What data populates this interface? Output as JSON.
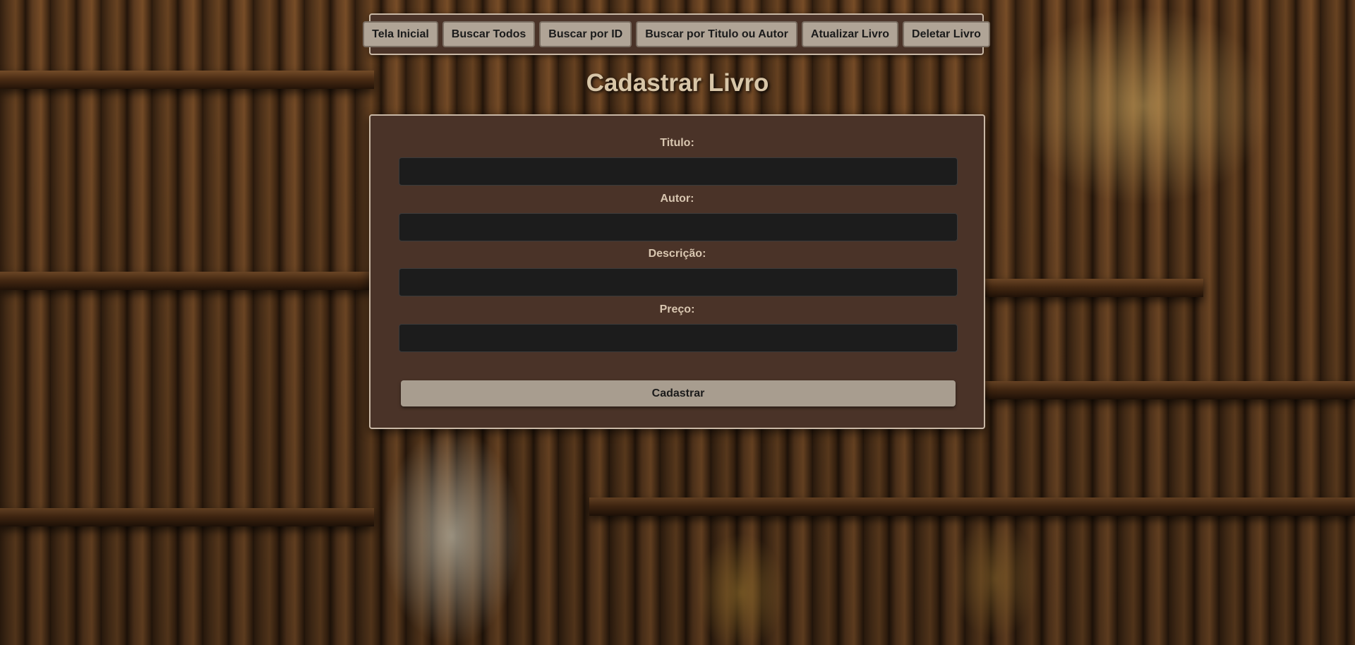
{
  "nav": {
    "items": [
      {
        "label": "Tela Inicial"
      },
      {
        "label": "Buscar Todos"
      },
      {
        "label": "Buscar por ID"
      },
      {
        "label": "Buscar por Titulo ou Autor"
      },
      {
        "label": "Atualizar Livro"
      },
      {
        "label": "Deletar Livro"
      }
    ]
  },
  "page": {
    "title": "Cadastrar Livro"
  },
  "form": {
    "fields": [
      {
        "label": "Titulo:",
        "value": ""
      },
      {
        "label": "Autor:",
        "value": ""
      },
      {
        "label": "Descrição:",
        "value": ""
      },
      {
        "label": "Preço:",
        "value": ""
      }
    ],
    "submit_label": "Cadastrar"
  },
  "colors": {
    "panel_bg": "#4a3328",
    "panel_border": "#c9b8a6",
    "button_bg": "#b0a496",
    "input_bg": "#1c1c1c",
    "title_color": "#d8c6a8"
  }
}
